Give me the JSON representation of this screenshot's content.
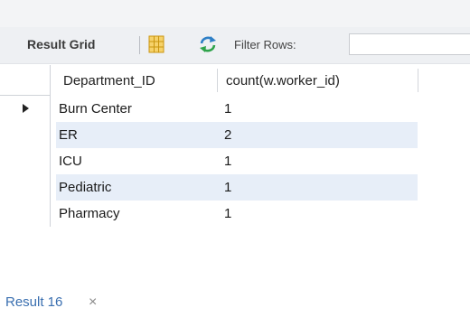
{
  "toolbar": {
    "result_grid_label": "Result Grid",
    "filter_label": "Filter Rows:",
    "filter_value": ""
  },
  "grid": {
    "columns": [
      "Department_ID",
      "count(w.worker_id)"
    ],
    "rows": [
      [
        "Burn Center",
        "1"
      ],
      [
        "ER",
        "2"
      ],
      [
        "ICU",
        "1"
      ],
      [
        "Pediatric",
        "1"
      ],
      [
        "Pharmacy",
        "1"
      ]
    ],
    "selected_row": 0
  },
  "tabs": [
    {
      "label": "Result 16",
      "close": "×"
    }
  ],
  "colors": {
    "accent": "#3a6fb0",
    "row_alt": "#e7eef8",
    "grid_icon": "#e8b21c",
    "refresh_icon": "#2e7fc6"
  }
}
